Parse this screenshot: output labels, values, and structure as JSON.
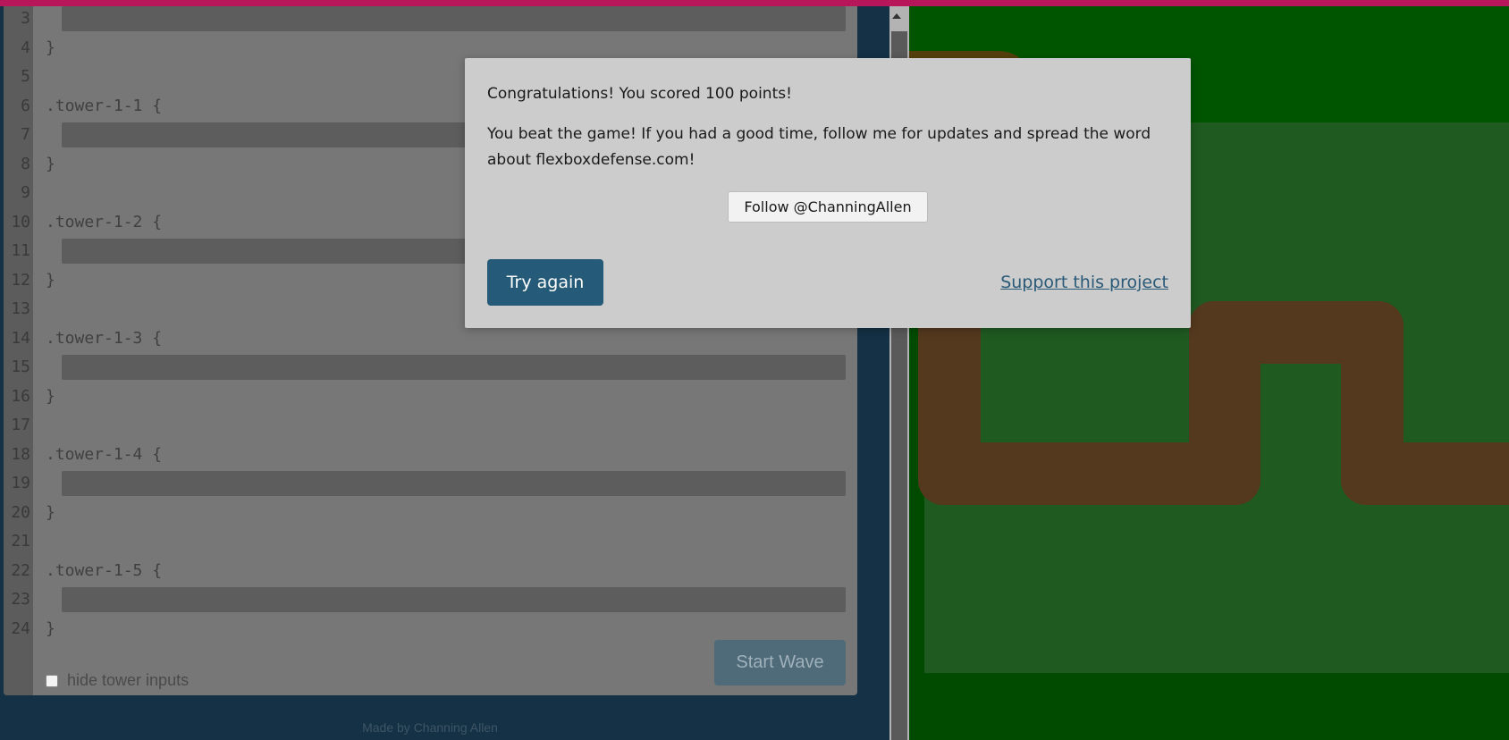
{
  "editor": {
    "lines": [
      {
        "num": "3",
        "code": ""
      },
      {
        "num": "4",
        "code": "}"
      },
      {
        "num": "5",
        "code": ""
      },
      {
        "num": "6",
        "code": ".tower-1-1 {"
      },
      {
        "num": "7",
        "code": ""
      },
      {
        "num": "8",
        "code": "}"
      },
      {
        "num": "9",
        "code": ""
      },
      {
        "num": "10",
        "code": ".tower-1-2 {"
      },
      {
        "num": "11",
        "code": ""
      },
      {
        "num": "12",
        "code": "}"
      },
      {
        "num": "13",
        "code": ""
      },
      {
        "num": "14",
        "code": ".tower-1-3 {"
      },
      {
        "num": "15",
        "code": ""
      },
      {
        "num": "16",
        "code": "}"
      },
      {
        "num": "17",
        "code": ""
      },
      {
        "num": "18",
        "code": ".tower-1-4 {"
      },
      {
        "num": "19",
        "code": ""
      },
      {
        "num": "20",
        "code": "}"
      },
      {
        "num": "21",
        "code": ""
      },
      {
        "num": "22",
        "code": ".tower-1-5 {"
      },
      {
        "num": "23",
        "code": ""
      },
      {
        "num": "24",
        "code": "}"
      }
    ],
    "hide_inputs_label": "hide tower inputs",
    "start_wave_label": "Start Wave"
  },
  "footer": {
    "credit": "Made by Channing Allen"
  },
  "modal": {
    "score_text": "Congratulations! You scored 100 points!",
    "beat_text_line1": "You beat the game! If you had a good time, follow me for updates and spread the word",
    "beat_text_line2": "about flexboxdefense.com!",
    "follow_label": "Follow @ChanningAllen",
    "try_again_label": "Try again",
    "support_label": "Support this project"
  },
  "colors": {
    "accent_bar": "#b8165a",
    "primary_button": "#255a78",
    "board_green": "#004b00",
    "path_brown": "#54391e"
  }
}
